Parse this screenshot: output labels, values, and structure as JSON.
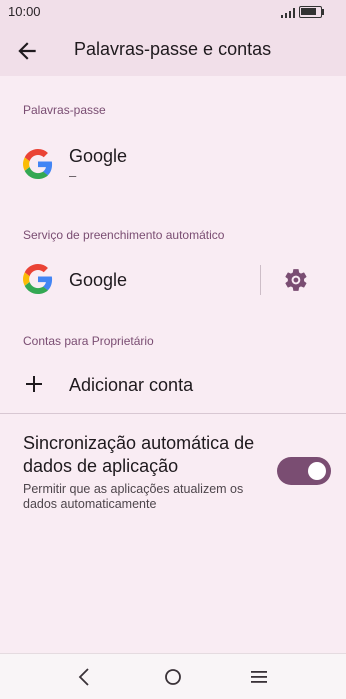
{
  "status_bar": {
    "time": "10:00"
  },
  "app_bar": {
    "title": "Palavras-passe e contas"
  },
  "sections": {
    "passwords": {
      "header": "Palavras-passe",
      "item": {
        "title": "Google",
        "subtitle": "–"
      }
    },
    "autofill": {
      "header": "Serviço de preenchimento automático",
      "item": {
        "title": "Google"
      }
    },
    "accounts": {
      "header": "Contas para Proprietário",
      "add_label": "Adicionar conta"
    }
  },
  "sync": {
    "title": "Sincronização automática de dados de aplicação",
    "subtitle": "Permitir que as aplicações atualizem os dados automaticamente",
    "enabled": true
  },
  "colors": {
    "accent": "#7a4d72",
    "background": "#f9ecf3",
    "app_bar": "#f1dfe9"
  },
  "icons": [
    "back-arrow-icon",
    "google-icon",
    "gear-icon",
    "plus-icon",
    "nav-back-icon",
    "nav-home-icon",
    "nav-menu-icon"
  ]
}
